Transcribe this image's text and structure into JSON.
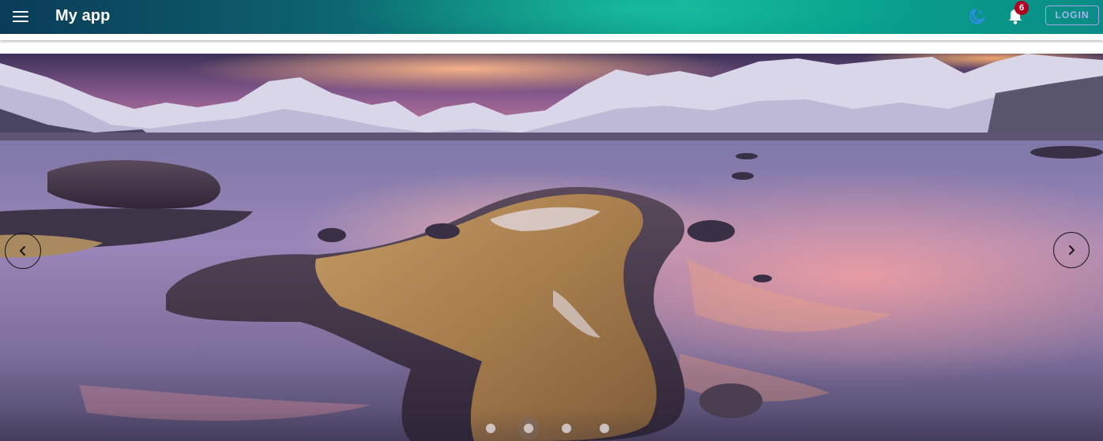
{
  "app_bar": {
    "title": "My app",
    "menu_icon": "hamburger-menu-icon",
    "theme_icon": "moon-stars-icon",
    "notifications_icon": "bell-icon",
    "notification_count": "6",
    "login_label": "LOGIN",
    "colors": {
      "gradient_start": "#0a3b58",
      "gradient_end": "#0aa58e",
      "theme_icon": "#2f8cf0",
      "badge": "#b00020",
      "login_border": "#9aa8e6"
    }
  },
  "carousel": {
    "slide_description_icon": "landscape-photo",
    "prev_icon": "chevron-left-icon",
    "next_icon": "chevron-right-icon",
    "slide_count": 4,
    "active_index": 1
  }
}
